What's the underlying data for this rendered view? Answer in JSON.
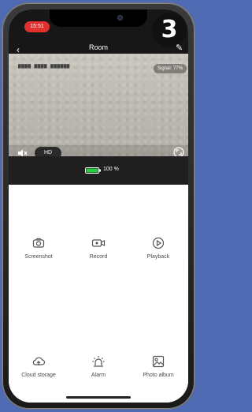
{
  "status_bar": {
    "time": "15:51"
  },
  "step_badge": "3",
  "header": {
    "title": "Room",
    "back_icon": "back-icon",
    "edit_icon": "edit-icon"
  },
  "video": {
    "signal": "Signal: 77%",
    "quality": "HD",
    "icons": [
      "mute-icon",
      "fullscreen-icon"
    ]
  },
  "battery": {
    "text": "100 %",
    "level": 1.0,
    "color": "#2ecc40"
  },
  "actions": [
    {
      "label": "Screenshot",
      "icon": "camera-icon"
    },
    {
      "label": "Record",
      "icon": "video-record-icon"
    },
    {
      "label": "Playback",
      "icon": "playback-icon"
    },
    {
      "label": "Cloud storage",
      "icon": "cloud-icon"
    },
    {
      "label": "Alarm",
      "icon": "alarm-icon"
    },
    {
      "label": "Photo album",
      "icon": "photo-icon"
    }
  ]
}
